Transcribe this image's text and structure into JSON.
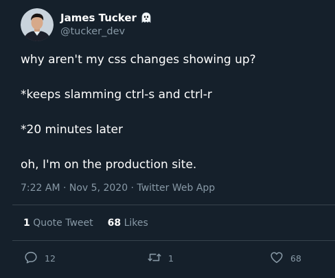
{
  "author": {
    "display_name": "James Tucker",
    "handle": "@tucker_dev",
    "name_emoji_icon": "ghost-icon"
  },
  "tweet": {
    "lines": [
      "why aren't my css changes showing up?",
      "*keeps slamming ctrl-s and ctrl-r",
      "*20 minutes later",
      "oh, I'm on the production site."
    ],
    "timestamp": "7:22 AM · Nov 5, 2020",
    "separator": " · ",
    "source_app": "Twitter Web App"
  },
  "stats": {
    "quote_count": "1",
    "quote_label": "Quote Tweet",
    "like_count": "68",
    "like_label": "Likes"
  },
  "actions": {
    "reply_count": "12",
    "retweet_count": "1",
    "like_count": "68"
  },
  "colors": {
    "background": "#15202b",
    "text": "#ffffff",
    "muted": "#8899a6",
    "divider": "#38444d"
  }
}
